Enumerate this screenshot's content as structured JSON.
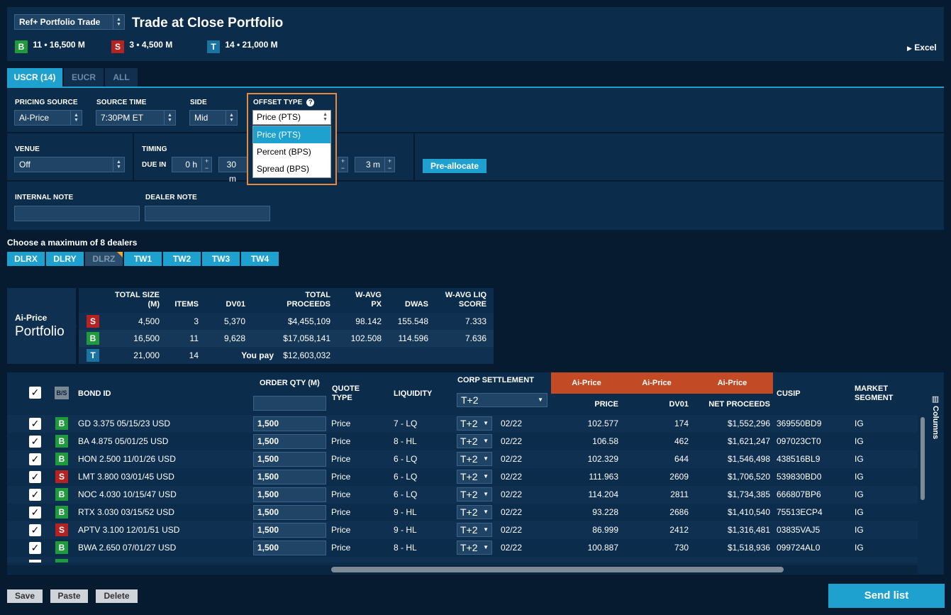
{
  "header": {
    "template_select": "Ref+ Portfolio Trade",
    "title": "Trade at Close Portfolio",
    "badges": [
      {
        "letter": "B",
        "text": "11 • 16,500 M",
        "color": "#1f9a3c"
      },
      {
        "letter": "S",
        "text": "3 • 4,500 M",
        "color": "#b52222"
      },
      {
        "letter": "T",
        "text": "14 • 21,000 M",
        "color": "#1a73a0"
      }
    ],
    "excel": "Excel"
  },
  "tabs": [
    {
      "label": "USCR (14)",
      "active": true
    },
    {
      "label": "EUCR",
      "active": false
    },
    {
      "label": "ALL",
      "active": false
    }
  ],
  "settings": {
    "pricing_source_label": "PRICING SOURCE",
    "pricing_source": "Ai-Price",
    "source_time_label": "SOURCE TIME",
    "source_time": "7:30PM ET",
    "side_label": "SIDE",
    "side": "Mid",
    "offset_type_label": "OFFSET TYPE",
    "offset_type": "Price (PTS)",
    "offset_options": [
      "Price (PTS)",
      "Percent (BPS)",
      "Spread (BPS)"
    ],
    "venue_label": "VENUE",
    "venue": "Off",
    "timing_label": "TIMING",
    "due_in_label": "DUE IN",
    "due_hours": "0 h",
    "due_minutes": "30 m",
    "step_last": "3 m",
    "preallocate": "Pre-allocate",
    "internal_note_label": "INTERNAL NOTE",
    "dealer_note_label": "DEALER NOTE"
  },
  "dealers": {
    "caption": "Choose a maximum of 8 dealers",
    "items": [
      "DLRX",
      "DLRY",
      "DLRZ",
      "TW1",
      "TW2",
      "TW3",
      "TW4"
    ]
  },
  "summary": {
    "source": "Ai-Price",
    "portfolio": "Portfolio",
    "headers": [
      "TOTAL SIZE\n(M)",
      "ITEMS",
      "DV01",
      "TOTAL\nPROCEEDS",
      "W-AVG\nPX",
      "DWAS",
      "W-AVG LIQ\nSCORE"
    ],
    "rows": [
      {
        "side": "S",
        "size": "4,500",
        "items": "3",
        "dv01": "5,370",
        "proceeds": "$4,455,109",
        "px": "98.142",
        "dwas": "155.548",
        "liq": "7.333"
      },
      {
        "side": "B",
        "size": "16,500",
        "items": "11",
        "dv01": "9,628",
        "proceeds": "$17,058,141",
        "px": "102.508",
        "dwas": "114.596",
        "liq": "7.636"
      },
      {
        "side": "T",
        "size": "21,000",
        "items": "14",
        "dv01": "You pay",
        "proceeds": "$12,603,032",
        "px": "",
        "dwas": "",
        "liq": ""
      }
    ]
  },
  "table": {
    "headers": {
      "bs": "B/S",
      "bond_id": "BOND ID",
      "order_qty": "ORDER QTY (M)",
      "quote_type": "QUOTE\nTYPE",
      "liquidity": "LIQUIDITY",
      "corp_settlement": "CORP SETTLEMENT",
      "corp_settlement_value": "T+2",
      "ai_price_1": "Ai-Price",
      "ai_price_2": "Ai-Price",
      "ai_price_3": "Ai-Price",
      "price": "PRICE",
      "dv01": "DV01",
      "net_proceeds": "NET PROCEEDS",
      "cusip": "CUSIP",
      "market_segment": "MARKET\nSEGMENT",
      "columns": "Columns"
    },
    "rows": [
      {
        "side": "B",
        "bond": "GD 3.375 05/15/23 USD",
        "qty": "1,500",
        "quote": "Price",
        "liq": "7 - LQ",
        "settle": "T+2",
        "date": "02/22",
        "price": "102.577",
        "dv01": "174",
        "net": "$1,552,296",
        "cusip": "369550BD9",
        "seg": "IG"
      },
      {
        "side": "B",
        "bond": "BA 4.875 05/01/25 USD",
        "qty": "1,500",
        "quote": "Price",
        "liq": "8 - HL",
        "settle": "T+2",
        "date": "02/22",
        "price": "106.58",
        "dv01": "462",
        "net": "$1,621,247",
        "cusip": "097023CT0",
        "seg": "IG"
      },
      {
        "side": "B",
        "bond": "HON 2.500 11/01/26 USD",
        "qty": "1,500",
        "quote": "Price",
        "liq": "6 - LQ",
        "settle": "T+2",
        "date": "02/22",
        "price": "102.329",
        "dv01": "644",
        "net": "$1,546,498",
        "cusip": "438516BL9",
        "seg": "IG"
      },
      {
        "side": "S",
        "bond": "LMT 3.800 03/01/45 USD",
        "qty": "1,500",
        "quote": "Price",
        "liq": "6 - LQ",
        "settle": "T+2",
        "date": "02/22",
        "price": "111.963",
        "dv01": "2609",
        "net": "$1,706,520",
        "cusip": "539830BD0",
        "seg": "IG"
      },
      {
        "side": "B",
        "bond": "NOC 4.030 10/15/47 USD",
        "qty": "1,500",
        "quote": "Price",
        "liq": "6 - LQ",
        "settle": "T+2",
        "date": "02/22",
        "price": "114.204",
        "dv01": "2811",
        "net": "$1,734,385",
        "cusip": "666807BP6",
        "seg": "IG"
      },
      {
        "side": "B",
        "bond": "RTX 3.030 03/15/52 USD",
        "qty": "1,500",
        "quote": "Price",
        "liq": "9 - HL",
        "settle": "T+2",
        "date": "02/22",
        "price": "93.228",
        "dv01": "2686",
        "net": "$1,410,540",
        "cusip": "75513ECP4",
        "seg": "IG"
      },
      {
        "side": "S",
        "bond": "APTV 3.100 12/01/51 USD",
        "qty": "1,500",
        "quote": "Price",
        "liq": "9 - HL",
        "settle": "T+2",
        "date": "02/22",
        "price": "86.999",
        "dv01": "2412",
        "net": "$1,316,481",
        "cusip": "03835VAJ5",
        "seg": "IG"
      },
      {
        "side": "B",
        "bond": "BWA 2.650 07/01/27 USD",
        "qty": "1,500",
        "quote": "Price",
        "liq": "8 - HL",
        "settle": "T+2",
        "date": "02/22",
        "price": "100.887",
        "dv01": "730",
        "net": "$1,518,936",
        "cusip": "099724AL0",
        "seg": "IG"
      }
    ]
  },
  "footer": {
    "save": "Save",
    "paste": "Paste",
    "delete": "Delete",
    "send_list": "Send list"
  },
  "colors": {
    "buy": "#1f9a3c",
    "sell": "#b52222",
    "total": "#1a73a0",
    "accent": "#1fa1d0",
    "ai_price_header": "#c24a24",
    "highlight_border": "#e88a3a"
  }
}
